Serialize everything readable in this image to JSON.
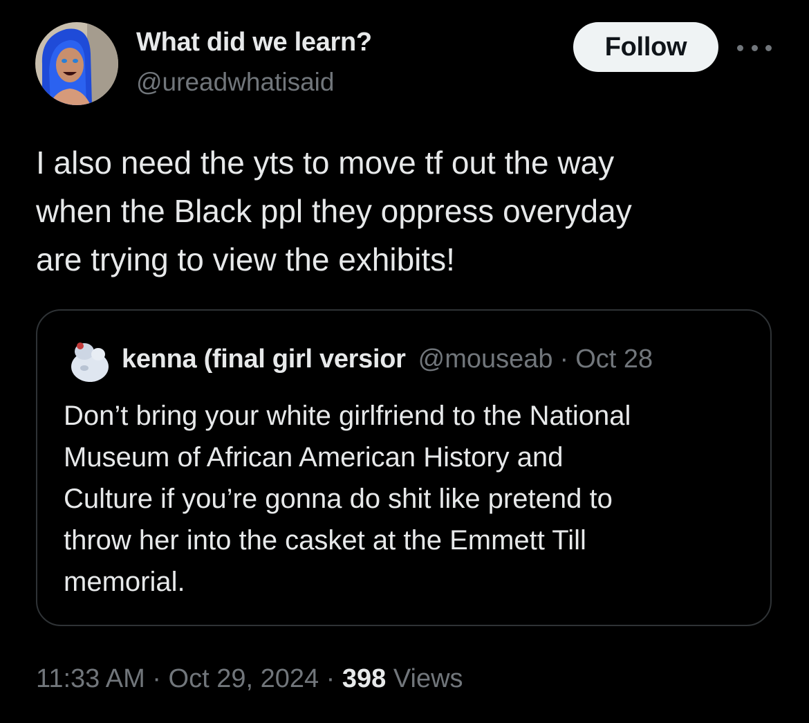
{
  "tweet": {
    "author": {
      "display_name": "What did we learn?",
      "handle": "@ureadwhatisaid",
      "avatar_icon": "profile-photo-avatar"
    },
    "follow_label": "Follow",
    "more_icon": "more-options-icon",
    "text": "I also need the yts to move tf out the way\nwhen the Black ppl they oppress overyday\nare trying to view the exhibits!",
    "quoted": {
      "author_name": "kenna (final girl versior",
      "author_handle": "@mouseab",
      "separator": "·",
      "date": "Oct 28",
      "avatar_icon": "profile-photo-avatar",
      "text": "Don’t bring your white girlfriend to the National\nMuseum of African American History and\nCulture if you’re gonna do shit like pretend to\nthrow her into the casket at the Emmett Till\nmemorial."
    },
    "meta": {
      "time": "11:33 AM",
      "separator": "·",
      "date": "Oct 29, 2024",
      "views_count": "398",
      "views_label": "Views"
    }
  },
  "colors": {
    "background": "#000000",
    "text_primary": "#e7e9ea",
    "text_secondary": "#71767b",
    "border": "#2f3336",
    "follow_button_bg": "#eff3f4",
    "follow_button_text": "#0f1419"
  }
}
